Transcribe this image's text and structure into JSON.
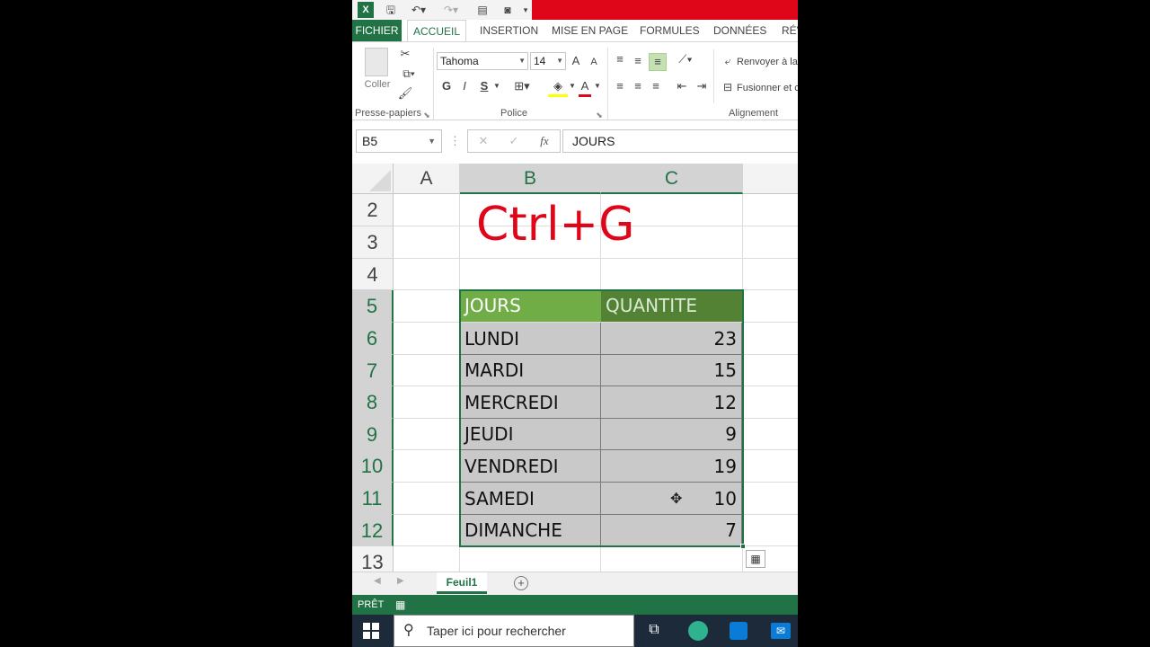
{
  "ribbon": {
    "tabs": [
      "FICHIER",
      "ACCUEIL",
      "INSERTION",
      "MISE EN PAGE",
      "FORMULES",
      "DONNÉES",
      "RÉV"
    ],
    "clipboard": {
      "paste_label": "Coller",
      "group_label": "Presse-papiers"
    },
    "font": {
      "name": "Tahoma",
      "size": "14",
      "bold": "G",
      "italic": "I",
      "underline": "S",
      "group_label": "Police",
      "grow": "A",
      "shrink": "A",
      "color": "A"
    },
    "alignment": {
      "wrap_label": "Renvoyer à la",
      "merge_label": "Fusionner et c",
      "group_label": "Alignement"
    }
  },
  "formula_bar": {
    "name_box": "B5",
    "fx": "fx",
    "cancel": "✕",
    "enter": "✓",
    "formula": "JOURS"
  },
  "grid": {
    "columns": [
      "A",
      "B",
      "C"
    ],
    "rows": [
      "2",
      "3",
      "4",
      "5",
      "6",
      "7",
      "8",
      "9",
      "10",
      "11",
      "12",
      "13"
    ],
    "overlay_text": "Ctrl+G",
    "table": {
      "header": [
        "JOURS",
        "QUANTITE"
      ],
      "rows": [
        {
          "day": "LUNDI",
          "qty": "23"
        },
        {
          "day": "MARDI",
          "qty": "15"
        },
        {
          "day": "MERCREDI",
          "qty": "12"
        },
        {
          "day": "JEUDI",
          "qty": "9"
        },
        {
          "day": "VENDREDI",
          "qty": "19"
        },
        {
          "day": "SAMEDI",
          "qty": "10"
        },
        {
          "day": "DIMANCHE",
          "qty": "7"
        }
      ]
    }
  },
  "sheets": {
    "active": "Feuil1"
  },
  "status": {
    "text": "PRÊT"
  },
  "taskbar": {
    "search_placeholder": "Taper ici pour rechercher"
  },
  "colors": {
    "excel_green": "#217346",
    "header_green": "#70ad47",
    "header_dark": "#548235",
    "accent_red": "#e0061a"
  }
}
